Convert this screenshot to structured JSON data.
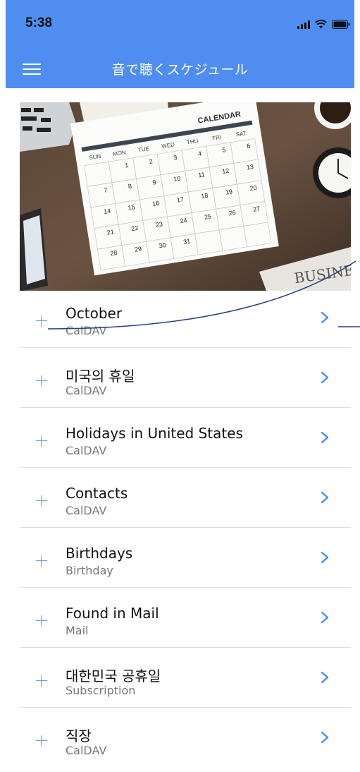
{
  "status_bar": {
    "time": "5:38"
  },
  "nav": {
    "title": "音で聴くスケジュール"
  },
  "hero": {
    "calendar_title": "CALENDAR",
    "weekdays": [
      "SUN",
      "MON",
      "TUE",
      "WED",
      "THU",
      "FRI",
      "SAT"
    ],
    "days": [
      "1",
      "2",
      "3",
      "4",
      "5",
      "6",
      "7",
      "8",
      "9",
      "10",
      "11",
      "12",
      "13",
      "14",
      "15",
      "16",
      "17",
      "18",
      "19",
      "20",
      "21",
      "22",
      "23",
      "24",
      "25",
      "26",
      "27",
      "28",
      "29",
      "30",
      "31"
    ],
    "newspaper_text": "BUSINE"
  },
  "calendars": [
    {
      "title": "October",
      "subtitle": "CalDAV"
    },
    {
      "title": "미국의 휴일",
      "subtitle": "CalDAV"
    },
    {
      "title": "Holidays in United States",
      "subtitle": "CalDAV"
    },
    {
      "title": "Contacts",
      "subtitle": "CalDAV"
    },
    {
      "title": "Birthdays",
      "subtitle": "Birthday"
    },
    {
      "title": "Found in Mail",
      "subtitle": "Mail"
    },
    {
      "title": "대한민국 공휴일",
      "subtitle": "Subscription"
    },
    {
      "title": "직장",
      "subtitle": "CalDAV"
    }
  ],
  "colors": {
    "header": "#4f8ef0",
    "accent": "#4f8ef0",
    "plus": "#6a9be8",
    "annotation_line": "#2b3f7a"
  },
  "icons": {
    "menu": "hamburger-menu-icon",
    "signal": "cellular-signal-icon",
    "wifi": "wifi-icon",
    "battery": "battery-icon",
    "add": "plus-icon",
    "disclosure": "chevron-right-icon"
  }
}
